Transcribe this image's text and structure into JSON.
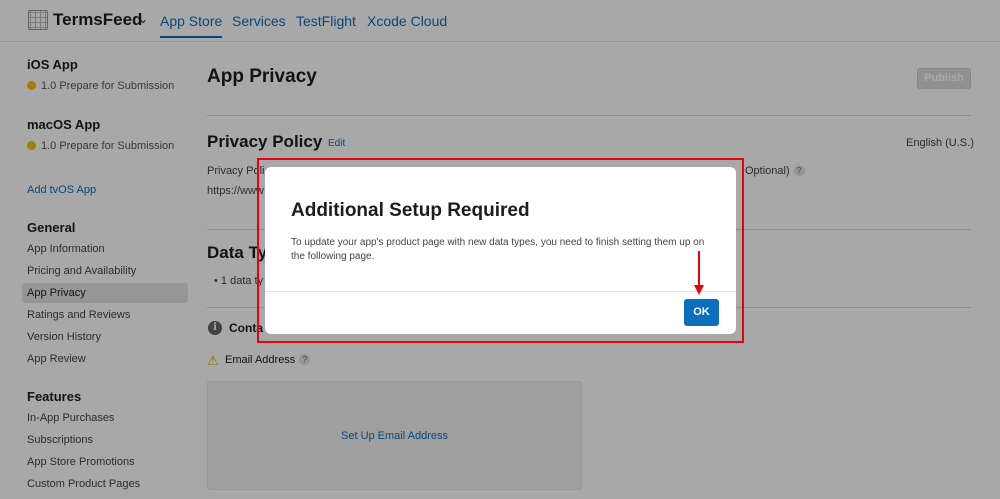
{
  "nav": {
    "brand": "TermsFeed",
    "tabs": [
      {
        "label": "App Store",
        "active": true
      },
      {
        "label": "Services"
      },
      {
        "label": "TestFlight"
      },
      {
        "label": "Xcode Cloud"
      }
    ]
  },
  "sidebar": {
    "apps": [
      {
        "name": "iOS App",
        "status": "1.0 Prepare for Submission"
      },
      {
        "name": "macOS App",
        "status": "1.0 Prepare for Submission"
      }
    ],
    "add_link": "Add tvOS App",
    "general_heading": "General",
    "general_items": [
      "App Information",
      "Pricing and Availability",
      "App Privacy",
      "Ratings and Reviews",
      "Version History",
      "App Review"
    ],
    "features_heading": "Features",
    "features_items": [
      "In-App Purchases",
      "Subscriptions",
      "App Store Promotions",
      "Custom Product Pages"
    ]
  },
  "main": {
    "title": "App Privacy",
    "publish_label": "Publish",
    "privacy_policy": {
      "title": "Privacy Policy",
      "edit_label": "Edit",
      "language": "English (U.S.)",
      "label_fragment": "Privacy Poli",
      "url_fragment": "https://www",
      "optional_fragment": "Optional)"
    },
    "data_types": {
      "title_fragment": "Data Ty",
      "bullet_fragment": "1 data ty"
    },
    "contact_fragment": "Conta",
    "email_label": "Email Address",
    "setup_link": "Set Up Email Address"
  },
  "modal": {
    "title": "Additional Setup Required",
    "body": "To update your app's product page with new data types, you need to finish setting them up on the following page.",
    "ok_label": "OK"
  },
  "colors": {
    "accent": "#0b6fbe",
    "annotation": "#e8000f",
    "status_dot": "#f2c200"
  }
}
